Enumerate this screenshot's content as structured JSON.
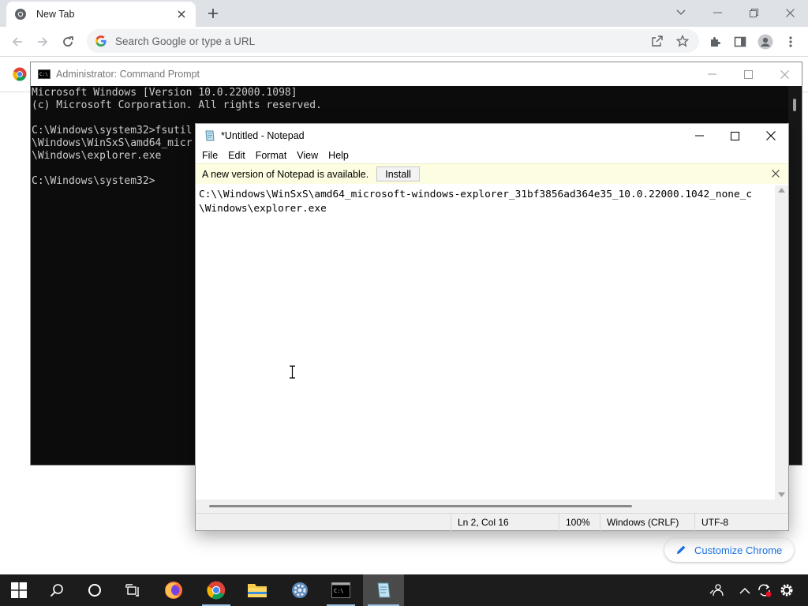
{
  "chrome": {
    "tab_title": "New Tab",
    "omnibox_placeholder": "Search Google or type a URL",
    "customize_label": "Customize Chrome",
    "accent_color": "#1a73e8"
  },
  "cmd": {
    "title": "Administrator: Command Prompt",
    "lines": [
      "Microsoft Windows [Version 10.0.22000.1098]",
      "(c) Microsoft Corporation. All rights reserved.",
      "",
      "C:\\Windows\\system32>fsutil",
      "\\Windows\\WinSxS\\amd64_micr",
      "\\Windows\\explorer.exe",
      "",
      "C:\\Windows\\system32>"
    ]
  },
  "notepad": {
    "title": "*Untitled - Notepad",
    "menu": [
      "File",
      "Edit",
      "Format",
      "View",
      "Help"
    ],
    "info_message": "A new version of Notepad is available.",
    "install_label": "Install",
    "content_lines": [
      "C:\\\\Windows\\WinSxS\\amd64_microsoft-windows-explorer_31bf3856ad364e35_10.0.22000.1042_none_c",
      "\\Windows\\explorer.exe"
    ],
    "status": {
      "position": "Ln 2, Col 16",
      "zoom": "100%",
      "line_ending": "Windows (CRLF)",
      "encoding": "UTF-8"
    }
  },
  "taskbar": {
    "items": [
      "start-icon",
      "search-icon",
      "cortana-icon",
      "task-view-icon",
      "firefox-icon",
      "chrome-icon",
      "file-explorer-icon",
      "settings-icon",
      "command-prompt-icon",
      "notepad-icon"
    ],
    "tray": [
      "people-icon",
      "chevron-up-icon",
      "sync-icon",
      "gear-icon"
    ]
  }
}
